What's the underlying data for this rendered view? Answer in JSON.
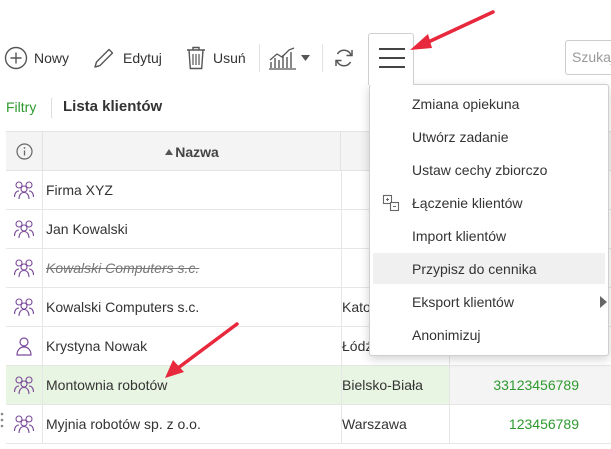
{
  "toolbar": {
    "new_label": "Nowy",
    "edit_label": "Edytuj",
    "delete_label": "Usuń",
    "search_placeholder": "Szukaj"
  },
  "breadcrumb": {
    "filters": "Filtry",
    "title": "Lista klientów"
  },
  "table": {
    "column_name": "Nazwa",
    "rows": [
      {
        "name": "Firma XYZ",
        "city": "",
        "phone": "",
        "icon": "group-icon",
        "strike": false,
        "highlight": false
      },
      {
        "name": "Jan Kowalski",
        "city": "",
        "phone": "",
        "icon": "group-icon",
        "strike": false,
        "highlight": false
      },
      {
        "name": "Kowalski Computers s.c.",
        "city": "",
        "phone": "",
        "icon": "group-icon",
        "strike": true,
        "highlight": false
      },
      {
        "name": "Kowalski Computers s.c.",
        "city": "Kato",
        "phone": "",
        "icon": "group-icon",
        "strike": false,
        "highlight": false
      },
      {
        "name": "Krystyna Nowak",
        "city": "Łódź",
        "phone": "",
        "icon": "person-icon",
        "strike": false,
        "highlight": false
      },
      {
        "name": "Montownia robotów",
        "city": "Bielsko-Biała",
        "phone": "33123456789",
        "icon": "group-icon",
        "strike": false,
        "highlight": true
      },
      {
        "name": "Myjnia robotów sp. z o.o.",
        "city": "Warszawa",
        "phone": "123456789",
        "icon": "group-icon",
        "strike": false,
        "highlight": false
      }
    ]
  },
  "menu": {
    "items": [
      {
        "label": "Zmiana opiekuna",
        "icon": "",
        "active": false,
        "submenu": false
      },
      {
        "label": "Utwórz zadanie",
        "icon": "",
        "active": false,
        "submenu": false
      },
      {
        "label": "Ustaw cechy zbiorczo",
        "icon": "",
        "active": false,
        "submenu": false
      },
      {
        "label": "Łączenie klientów",
        "icon": "merge-icon",
        "active": false,
        "submenu": false
      },
      {
        "label": "Import klientów",
        "icon": "",
        "active": false,
        "submenu": false
      },
      {
        "label": "Przypisz do cennika",
        "icon": "",
        "active": true,
        "submenu": false
      },
      {
        "label": "Eksport klientów",
        "icon": "",
        "active": false,
        "submenu": true
      },
      {
        "label": "Anonimizuj",
        "icon": "",
        "active": false,
        "submenu": false
      }
    ]
  },
  "colors": {
    "accent_green": "#2e9a2e",
    "arrow_red": "#e8283c",
    "highlight_row": "#e8f5e3"
  }
}
